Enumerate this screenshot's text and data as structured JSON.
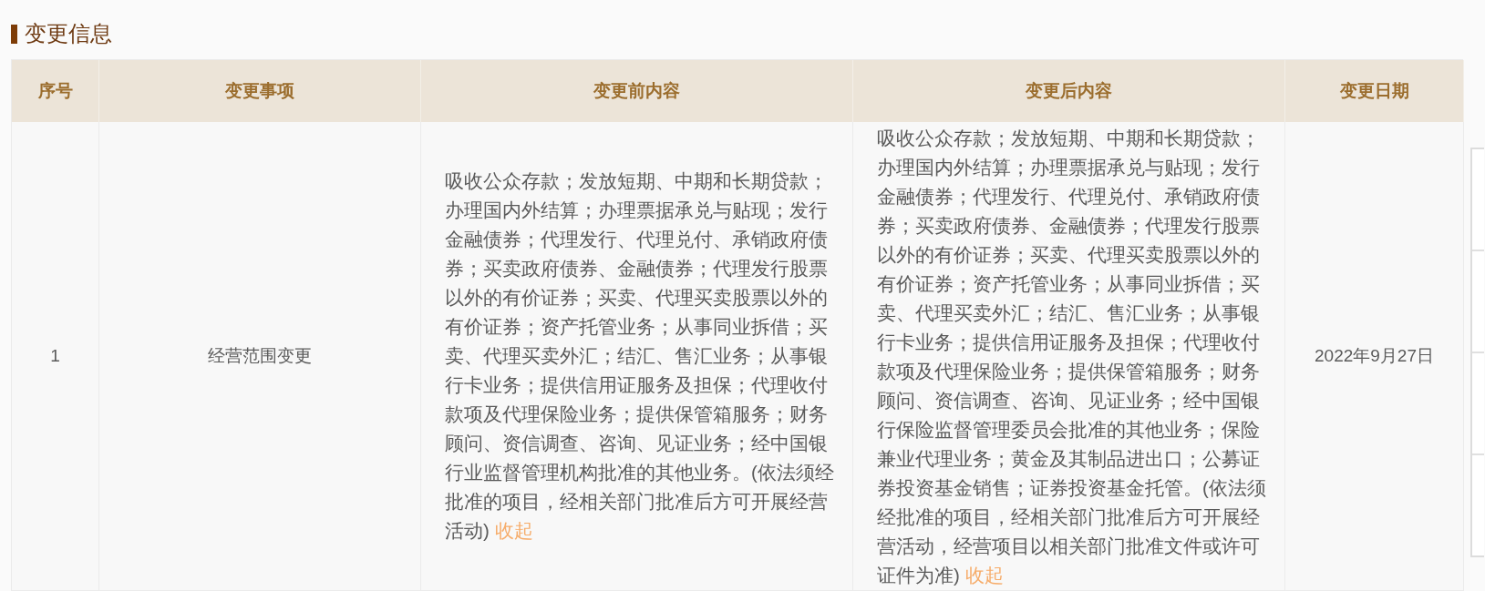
{
  "section_title": "变更信息",
  "table": {
    "columns": [
      "序号",
      "变更事项",
      "变更前内容",
      "变更后内容",
      "变更日期"
    ],
    "rows": [
      {
        "index": "1",
        "item": "经营范围变更",
        "before": "吸收公众存款；发放短期、中期和长期贷款；办理国内外结算；办理票据承兑与贴现；发行金融债券；代理发行、代理兑付、承销政府债券；买卖政府债券、金融债券；代理发行股票以外的有价证券；买卖、代理买卖股票以外的有价证券；资产托管业务；从事同业拆借；买卖、代理买卖外汇；结汇、售汇业务；从事银行卡业务；提供信用证服务及担保；代理收付款项及代理保险业务；提供保管箱服务；财务顾问、资信调查、咨询、见证业务；经中国银行业监督管理机构批准的其他业务。(依法须经批准的项目，经相关部门批准后方可开展经营活动)",
        "before_link": "收起",
        "after": "吸收公众存款；发放短期、中期和长期贷款；办理国内外结算；办理票据承兑与贴现；发行金融债券；代理发行、代理兑付、承销政府债券；买卖政府债券、金融债券；代理发行股票以外的有价证券；买卖、代理买卖股票以外的有价证券；资产托管业务；从事同业拆借；买卖、代理买卖外汇；结汇、售汇业务；从事银行卡业务；提供信用证服务及担保；代理收付款项及代理保险业务；提供保管箱服务；财务顾问、资信调查、咨询、见证业务；经中国银行保险监督管理委员会批准的其他业务；保险兼业代理业务；黄金及其制品进出口；公募证券投资基金销售；证券投资基金托管。(依法须经批准的项目，经相关部门批准后方可开展经营活动，经营项目以相关部门批准文件或许可证件为准)",
        "after_link": "收起",
        "date": "2022年9月27日"
      }
    ]
  }
}
